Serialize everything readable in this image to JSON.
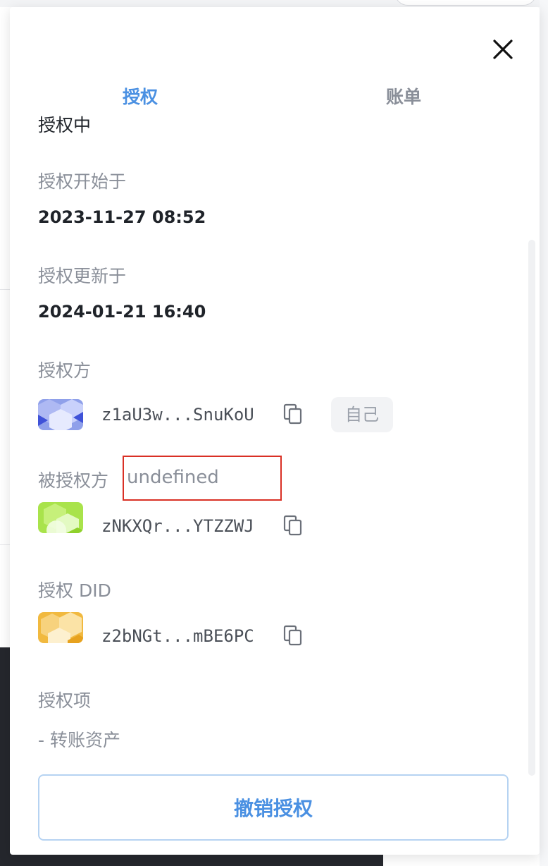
{
  "tabs": [
    {
      "label": "授权",
      "active": true
    },
    {
      "label": "账单",
      "active": false
    }
  ],
  "status": "授权中",
  "start": {
    "label": "授权开始于",
    "value": "2023-11-27 08:52"
  },
  "updated": {
    "label": "授权更新于",
    "value": "2024-01-21 16:40"
  },
  "grantor": {
    "label": "授权方",
    "did": "z1aU3w...SnuKoU",
    "badge": "自己"
  },
  "grantee": {
    "label": "被授权方",
    "suffix": "undefined",
    "did": "zNKXQr...YTZZWJ"
  },
  "auth_did": {
    "label": "授权 DID",
    "did": "z2bNGt...mBE6PC"
  },
  "scope": {
    "label": "授权项",
    "item": "- 转账资产"
  },
  "revoke_button": "撤销授权",
  "icons": {
    "close": "close-icon",
    "copy": "copy-icon"
  },
  "colors": {
    "accent": "#4a90e2",
    "highlight_border": "#d93025"
  }
}
